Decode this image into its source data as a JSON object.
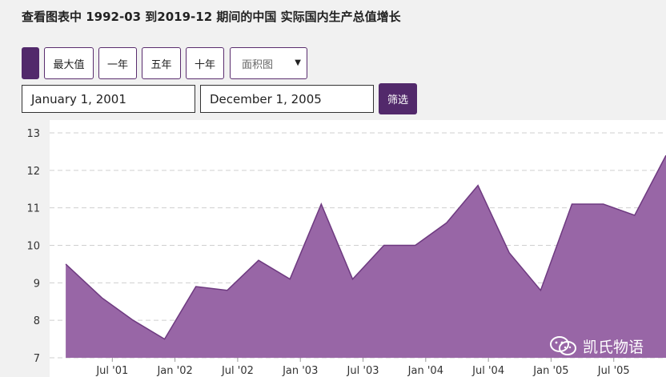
{
  "title": "查看图表中 1992-03 到2019-12 期间的中国 实际国内生产总值增长",
  "controls": {
    "buttons": [
      {
        "label": ""
      },
      {
        "label": "最大值"
      },
      {
        "label": "一年"
      },
      {
        "label": "五年"
      },
      {
        "label": "十年"
      }
    ],
    "chart_type_select": "面积图",
    "start_date": "January 1, 2001",
    "end_date": "December 1, 2005",
    "filter_label": "筛选"
  },
  "watermark": "凯氏物语",
  "colors": {
    "accent": "#52296b",
    "area_fill": "#9866a6",
    "area_stroke": "#6e3a80",
    "grid": "#cfcfcf"
  },
  "chart_data": {
    "type": "area",
    "x": [
      "2001-03",
      "2001-06",
      "2001-09",
      "2001-12",
      "2002-03",
      "2002-06",
      "2002-09",
      "2002-12",
      "2003-03",
      "2003-06",
      "2003-09",
      "2003-12",
      "2004-03",
      "2004-06",
      "2004-09",
      "2004-12",
      "2005-03",
      "2005-06",
      "2005-09",
      "2005-12"
    ],
    "series": [
      {
        "values": [
          9.5,
          8.6,
          8.0,
          7.5,
          8.9,
          8.8,
          9.6,
          9.1,
          11.1,
          9.1,
          10.0,
          10.0,
          10.6,
          11.6,
          9.8,
          8.8,
          11.1,
          11.1,
          10.8,
          12.4
        ]
      }
    ],
    "xticks": [
      "Jul '01",
      "Jan '02",
      "Jul '02",
      "Jan '03",
      "Jul '03",
      "Jan '04",
      "Jul '04",
      "Jan '05",
      "Jul '05"
    ],
    "xtick_dates": [
      "2001-07",
      "2002-01",
      "2002-07",
      "2003-01",
      "2003-07",
      "2004-01",
      "2004-07",
      "2005-01",
      "2005-07"
    ],
    "yticks": [
      7,
      8,
      9,
      10,
      11,
      12,
      13
    ],
    "ylim": [
      7,
      13
    ],
    "grid": true,
    "title": "",
    "xlabel": "",
    "ylabel": ""
  }
}
